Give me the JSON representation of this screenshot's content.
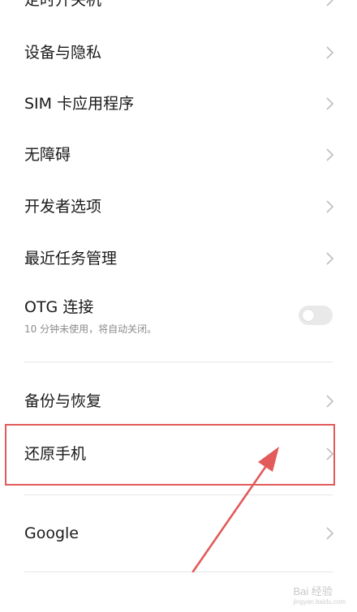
{
  "settings": {
    "items": [
      {
        "label": "定时开关机"
      },
      {
        "label": "设备与隐私"
      },
      {
        "label": "SIM 卡应用程序"
      },
      {
        "label": "无障碍"
      },
      {
        "label": "开发者选项"
      },
      {
        "label": "最近任务管理"
      },
      {
        "label": "OTG 连接",
        "subtitle": "10 分钟未使用，将自动关闭。",
        "toggle_on": false
      },
      {
        "label": "备份与恢复"
      },
      {
        "label": "还原手机"
      },
      {
        "label": "Google"
      }
    ]
  },
  "annotation": {
    "highlight_color": "#e25a5a"
  },
  "watermark": {
    "text": "Bai 经验",
    "url": "jingyan.baidu.com"
  }
}
